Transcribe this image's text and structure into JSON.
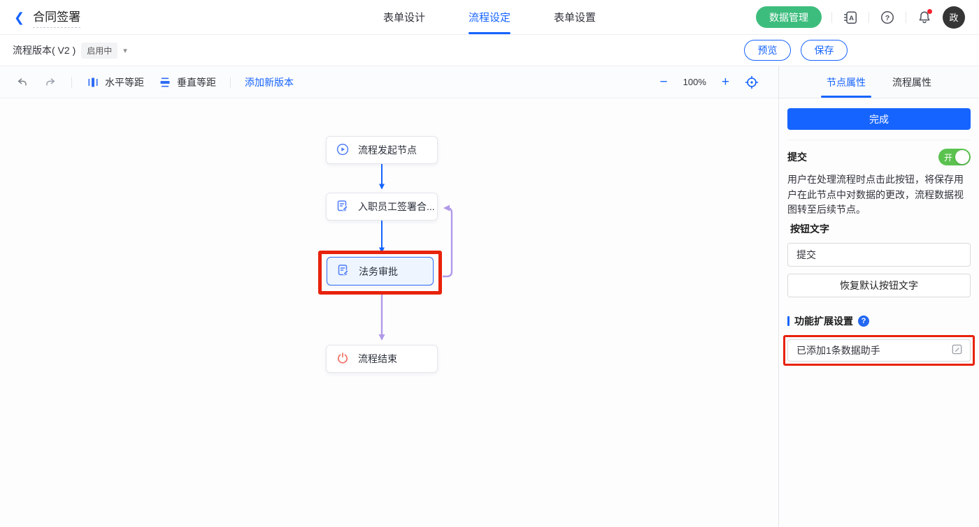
{
  "header": {
    "title": "合同签署",
    "tabs": [
      {
        "label": "表单设计",
        "active": false
      },
      {
        "label": "流程设定",
        "active": true
      },
      {
        "label": "表单设置",
        "active": false
      }
    ],
    "data_manage_button": "数据管理",
    "avatar_text": "政",
    "icons": [
      "translate-icon",
      "help-icon",
      "notification-bell-icon"
    ]
  },
  "subheader": {
    "version_label": "流程版本( V2 )",
    "status_badge": "启用中",
    "preview_button": "预览",
    "save_button": "保存"
  },
  "toolbar": {
    "horizontal_spacing_label": "水平等距",
    "vertical_spacing_label": "垂直等距",
    "add_version_link": "添加新版本",
    "zoom_out": "−",
    "zoom_level": "100%",
    "zoom_in": "+"
  },
  "canvas": {
    "nodes": [
      {
        "label": "流程发起节点",
        "icon": "play-circle-icon",
        "selected": false
      },
      {
        "label": "入职员工签署合...",
        "icon": "document-edit-icon",
        "selected": false
      },
      {
        "label": "法务审批",
        "icon": "document-edit-icon",
        "selected": true,
        "annotated": true
      },
      {
        "label": "流程结束",
        "icon": "power-icon",
        "selected": false
      }
    ],
    "connections": [
      {
        "from": 0,
        "to": 1,
        "color": "#1664ff"
      },
      {
        "from": 1,
        "to": 2,
        "color": "#1664ff"
      },
      {
        "from": 2,
        "to": 3,
        "color": "#b19ae9"
      },
      {
        "from": 2,
        "to": 1,
        "color": "#b19ae9",
        "type": "loop-back"
      }
    ]
  },
  "panel": {
    "tabs": [
      {
        "label": "节点属性",
        "active": true
      },
      {
        "label": "流程属性",
        "active": false
      }
    ],
    "complete_button": "完成",
    "submit": {
      "label": "提交",
      "toggle_state": "开"
    },
    "description": "用户在处理流程时点击此按钮，将保存用户在此节点中对数据的更改，流程数据视图转至后续节点。",
    "button_text_label": "按钮文字",
    "button_text_value": "提交",
    "restore_button": "恢复默认按钮文字",
    "extension": {
      "title": "功能扩展设置",
      "field_value": "已添加1条数据助手"
    }
  },
  "colors": {
    "accent_blue": "#1664ff",
    "brand_green": "#3dbd7d",
    "toggle_green": "#5bc24f",
    "annotation_red": "#e8220b",
    "connector_blue": "#1664ff",
    "connector_purple": "#b19ae9",
    "end_node_red": "#f2695c"
  }
}
